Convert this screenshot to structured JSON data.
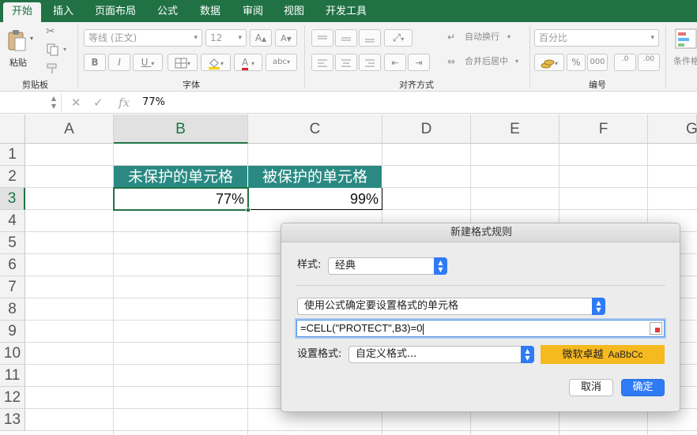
{
  "tabs": [
    "开始",
    "插入",
    "页面布局",
    "公式",
    "数据",
    "审阅",
    "视图",
    "开发工具"
  ],
  "ribbon": {
    "paste_label": "粘贴",
    "group_clipboard": "剪贴板",
    "group_font": "字体",
    "group_alignment": "对齐方式",
    "group_number": "编号",
    "font_name": "等线 (正文)",
    "font_size": "12",
    "bold": "B",
    "italic": "I",
    "underline": "U",
    "font_color_glyph": "A",
    "grow_font": "A",
    "shrink_font": "A",
    "phonetic": "abc",
    "wrap_text": "自动换行",
    "merge_center": "合并后居中",
    "number_format": "百分比",
    "percent": "%",
    "comma": "000",
    "inc_decimal": ".0",
    "dec_decimal": ".00",
    "conditional_format": "条件格"
  },
  "formula_bar": {
    "value": "77%",
    "fx": "fx",
    "cancel_glyph": "✕",
    "enter_glyph": "✓"
  },
  "columns": [
    "A",
    "B",
    "C",
    "D",
    "E",
    "F",
    "G"
  ],
  "rows": [
    "1",
    "2",
    "3",
    "4",
    "5",
    "6",
    "7",
    "8",
    "9",
    "10",
    "11",
    "12",
    "13"
  ],
  "cells": {
    "B2": "未保护的单元格",
    "C2": "被保护的单元格",
    "B3": "77%",
    "C3": "99%"
  },
  "colors": {
    "accent": "#207245",
    "header_fill": "#2a8a83",
    "preview_fill": "#f6b91f",
    "button_blue": "#2f7bf5"
  },
  "dialog": {
    "title": "新建格式规则",
    "style_label": "样式:",
    "style_value": "经典",
    "rule_type": "使用公式确定要设置格式的单元格",
    "formula": "=CELL(\"PROTECT\",B3)=0",
    "format_label": "设置格式:",
    "format_value": "自定义格式...",
    "preview_text": "微软卓越",
    "preview_sample": "AaBbCc",
    "cancel_label": "取消",
    "ok_label": "确定"
  }
}
